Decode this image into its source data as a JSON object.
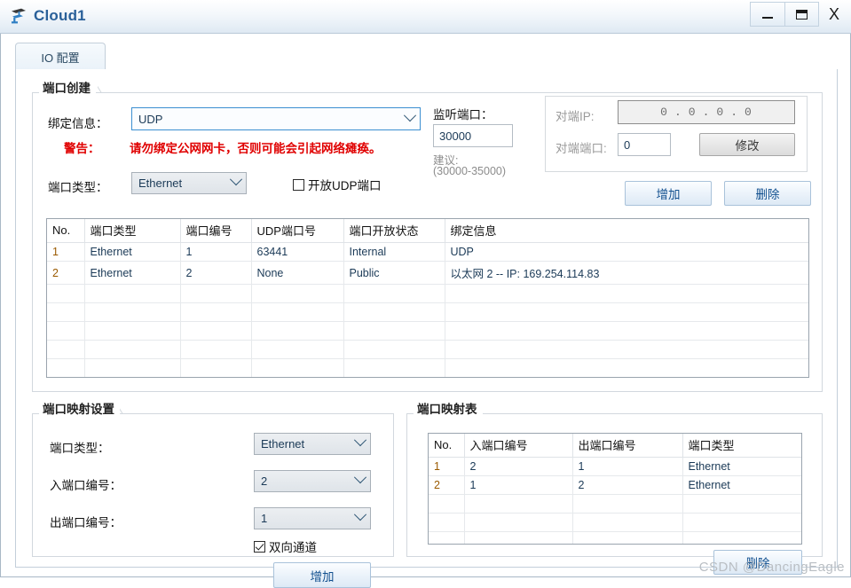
{
  "window": {
    "title": "Cloud1",
    "icon": "cloud-device-icon",
    "controls": {
      "minimize": "minimize-icon",
      "maximize": "maximize-icon",
      "close": "X"
    }
  },
  "tabs": [
    {
      "label": "IO 配置",
      "active": true
    }
  ],
  "port_create": {
    "title": "端口创建",
    "binding_label": "绑定信息：",
    "binding_value": "UDP",
    "warning_key": "警告：",
    "warning_text": "请勿绑定公网网卡，否则可能会引起网络瘫痪。",
    "port_type_label": "端口类型：",
    "port_type_value": "Ethernet",
    "open_udp_label": "开放UDP端口",
    "open_udp_checked": false,
    "listen_port_label": "监听端口：",
    "listen_port_value": "30000",
    "suggest_label": "建议:",
    "suggest_range": "(30000-35000)",
    "peer_ip_label": "对端IP:",
    "peer_ip_octets": [
      "0",
      "0",
      "0",
      "0"
    ],
    "peer_port_label": "对端端口:",
    "peer_port_value": "0",
    "modify_button": "修改",
    "add_button": "增加",
    "delete_button": "删除"
  },
  "port_table": {
    "columns": [
      "No.",
      "端口类型",
      "端口编号",
      "UDP端口号",
      "端口开放状态",
      "绑定信息"
    ],
    "rows": [
      [
        "1",
        "Ethernet",
        "1",
        "63441",
        "Internal",
        "UDP"
      ],
      [
        "2",
        "Ethernet",
        "2",
        "None",
        "Public",
        "以太网 2 -- IP: 169.254.114.83"
      ]
    ],
    "empty_rows": 6
  },
  "mapping_settings": {
    "title": "端口映射设置",
    "port_type_label": "端口类型：",
    "port_type_value": "Ethernet",
    "in_port_label": "入端口编号：",
    "in_port_value": "2",
    "out_port_label": "出端口编号：",
    "out_port_value": "1",
    "bidirectional_label": "双向通道",
    "bidirectional_checked": true,
    "add_button": "增加"
  },
  "mapping_table": {
    "title": "端口映射表",
    "columns": [
      "No.",
      "入端口编号",
      "出端口编号",
      "端口类型"
    ],
    "rows": [
      [
        "1",
        "2",
        "1",
        "Ethernet"
      ],
      [
        "2",
        "1",
        "2",
        "Ethernet"
      ]
    ],
    "empty_rows": 3,
    "delete_button": "删除"
  },
  "watermark": "CSDN @DancingEagle",
  "colors": {
    "title_blue": "#2a6099",
    "warning_red": "#e00000",
    "button_blue_text": "#12508f",
    "cell_blue": "#1b3a57",
    "number_orange": "#9a5a00"
  }
}
